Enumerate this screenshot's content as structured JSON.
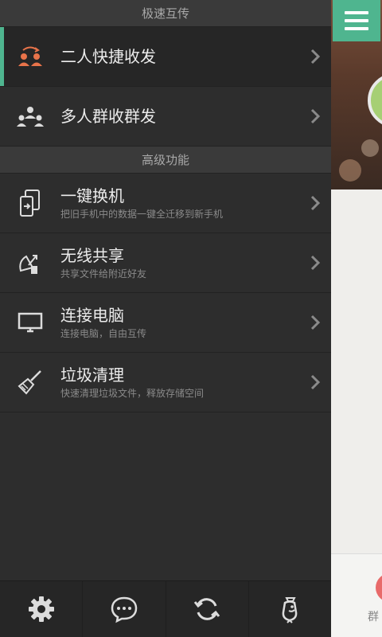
{
  "sections": [
    {
      "header": "极速互传",
      "items": [
        {
          "title": "二人快捷收发",
          "subtitle": "",
          "icon": "two-person-transfer-icon"
        },
        {
          "title": "多人群收群发",
          "subtitle": "",
          "icon": "group-transfer-icon"
        }
      ]
    },
    {
      "header": "高级功能",
      "items": [
        {
          "title": "一键换机",
          "subtitle": "把旧手机中的数据一键全迁移到新手机",
          "icon": "phone-switch-icon"
        },
        {
          "title": "无线共享",
          "subtitle": "共享文件给附近好友",
          "icon": "wireless-share-icon"
        },
        {
          "title": "连接电脑",
          "subtitle": "连接电脑，自由互传",
          "icon": "monitor-icon"
        },
        {
          "title": "垃圾清理",
          "subtitle": "快速清理垃圾文件，释放存储空间",
          "icon": "broom-icon"
        }
      ]
    }
  ],
  "bottom_bar": [
    "settings-icon",
    "message-icon",
    "refresh-icon",
    "mascot-icon"
  ],
  "peek": {
    "bottom_label": "群"
  },
  "colors": {
    "accent": "#4fb58f",
    "icon_orange": "#e8734a"
  }
}
